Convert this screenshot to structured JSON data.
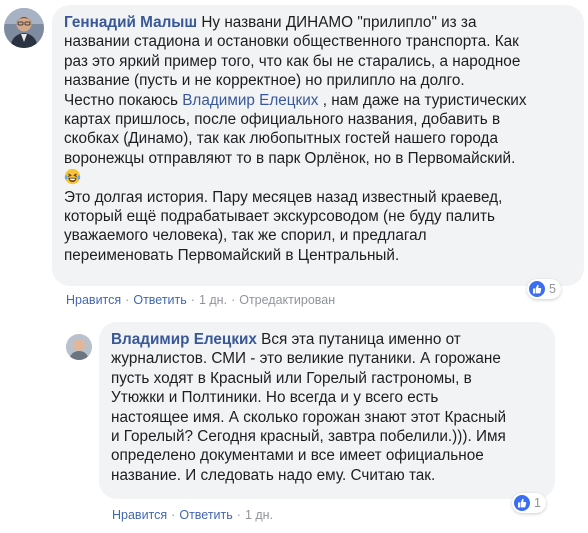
{
  "comment1": {
    "author": "Геннадий Малыш",
    "text_before_mention": "Ну названи ДИНАМО \"прилипло\" из за\nназвании стадиона и остановки общественного транспорта. Как\nраз это яркий пример того, что как бы не старались, а народное\nназвание (пусть и не корректное) но прилипло на долго.\nЧестно покаюсь ",
    "mention": "Владимир Елецких",
    "text_after_mention": " , нам даже на туристических\nкартах пришлось, после официального названия, добавить в\nскобках (Динамо), так как любопытных гостей нашего города\nворонежцы отправляют то в парк Орлёнок, но в Первомайский.\n",
    "emoji": "laughing-tears-emoji",
    "text_end": "\nЭто долгая история. Пару месяцев назад известный краевед,\nкоторый ещё подрабатывает экскурсоводом (не буду палить\nуважаемого человека), так же спорил, и предлагал\nпереименовать Первомайский в Центральный.",
    "actions": {
      "like": "Нравится",
      "reply": "Ответить",
      "time": "1 дн.",
      "edited": "Отредактирован"
    },
    "reactions": {
      "icon": "thumbs-up-icon",
      "count": "5"
    }
  },
  "comment2": {
    "author": "Владимир Елецких",
    "text": " Вся эта путаница именно от\nжурналистов. СМИ - это великие путаники. А горожане\nпусть ходят в Красный или Горелый гастрономы, в\nУтюжки и Полтиники. Но всегда и у всего есть\nнастоящее имя. А сколько горожан знают этот Красный\nи Горелый? Сегодня красный, завтра побелили.))). Имя\nопределено документами и все имеет официальное\nназвание. И следовать надо ему. Считаю так.",
    "actions": {
      "like": "Нравится",
      "reply": "Ответить",
      "time": "1 дн."
    },
    "reactions": {
      "icon": "thumbs-up-icon",
      "count": "1"
    }
  },
  "colors": {
    "bubble": "#f2f3f5",
    "author": "#385898",
    "link": "#4267b2",
    "meta": "#90949c",
    "like": "#3b6ef0"
  }
}
